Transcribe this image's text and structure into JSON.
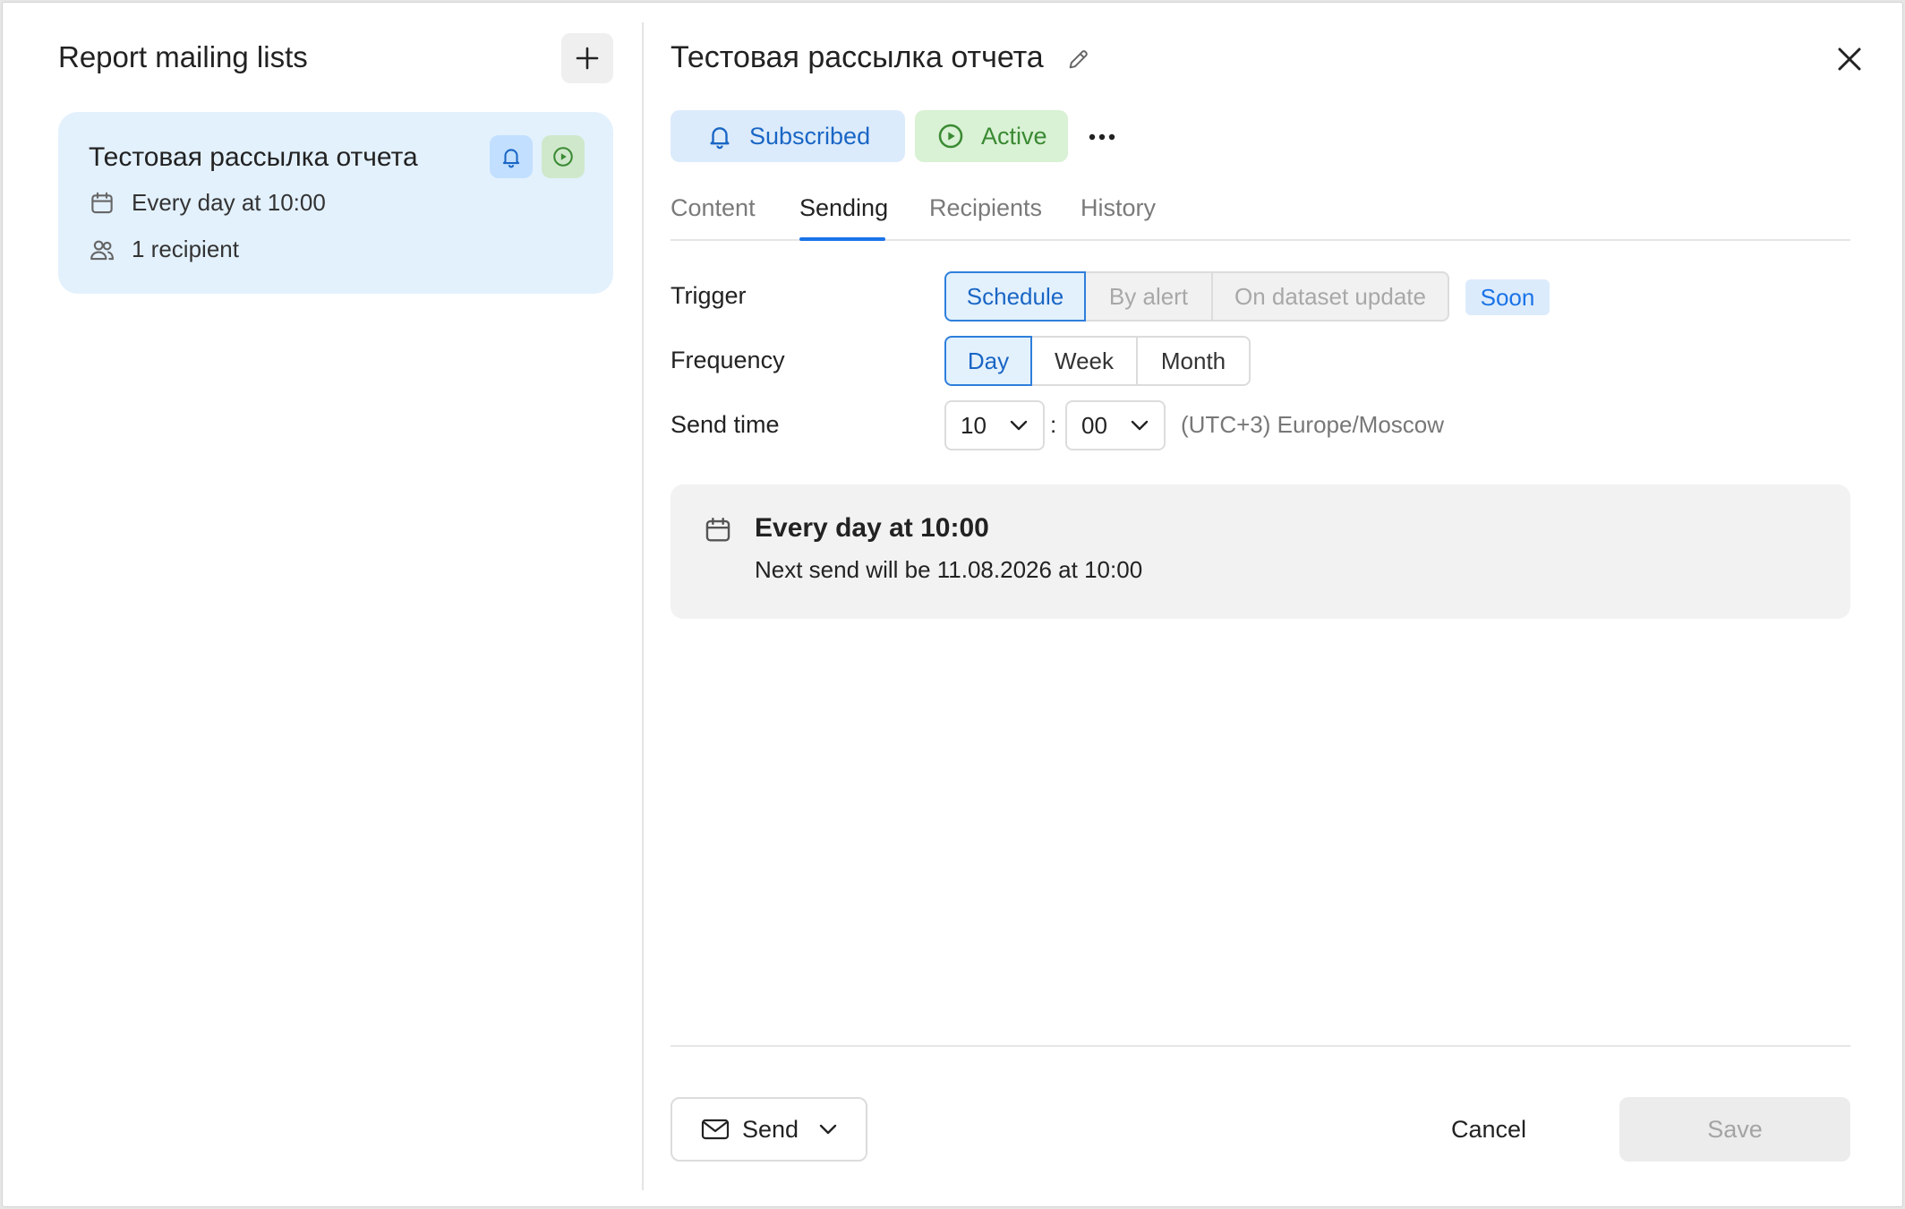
{
  "left": {
    "title": "Report mailing lists",
    "list": [
      {
        "title": "Тестовая рассылка отчета",
        "schedule": "Every day at 10:00",
        "recipients": "1 recipient"
      }
    ]
  },
  "detail": {
    "title": "Тестовая рассылка отчета",
    "subscribed_label": "Subscribed",
    "active_label": "Active",
    "tabs": [
      "Content",
      "Sending",
      "Recipients",
      "History"
    ],
    "active_tab": "Sending",
    "trigger": {
      "label": "Trigger",
      "options": [
        "Schedule",
        "By alert",
        "On dataset update"
      ],
      "selected": "Schedule",
      "soon_badge": "Soon"
    },
    "frequency": {
      "label": "Frequency",
      "options": [
        "Day",
        "Week",
        "Month"
      ],
      "selected": "Day"
    },
    "send_time": {
      "label": "Send time",
      "hour": "10",
      "minute": "00",
      "separator": ":",
      "timezone": "(UTC+3) Europe/Moscow"
    },
    "summary": {
      "title": "Every day at 10:00",
      "next_send": "Next send will be 11.08.2026 at 10:00"
    },
    "footer": {
      "send_label": "Send",
      "cancel_label": "Cancel",
      "save_label": "Save"
    }
  },
  "colors": {
    "accent": "#1a73e8",
    "card_bg": "#e3f1fd",
    "active_green": "#3a8a33"
  },
  "icons": [
    "plus-icon",
    "bell-icon",
    "play-circle-icon",
    "calendar-icon",
    "users-icon",
    "pencil-icon",
    "close-icon",
    "more-dots-icon",
    "chevron-down-icon",
    "envelope-icon"
  ]
}
